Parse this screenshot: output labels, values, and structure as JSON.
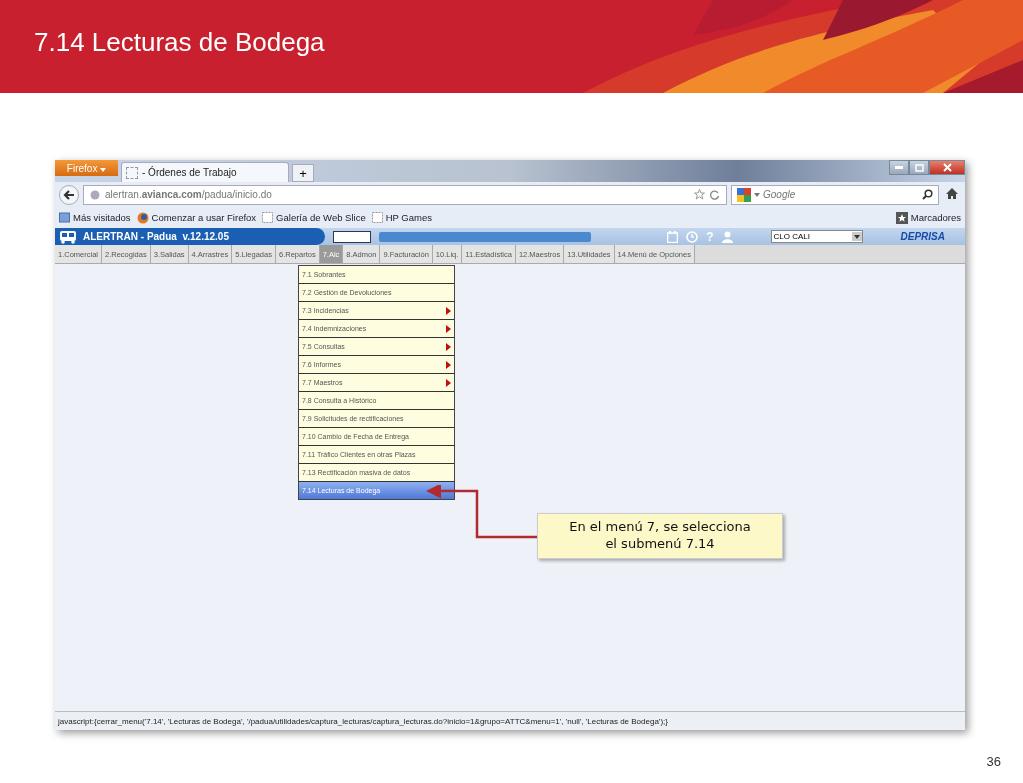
{
  "slide": {
    "title": "7.14 Lecturas de Bodega",
    "page_number": "36"
  },
  "browser": {
    "firefox_button": "Firefox",
    "tab_title": "- Órdenes de Trabajo",
    "new_tab": "+",
    "url": "alertran.**avianca.com**/padua/inicio.do",
    "search_placeholder": "Google",
    "bookmarks": [
      "Más visitados",
      "Comenzar a usar Firefox",
      "Galería de Web Slice",
      "HP Games"
    ],
    "bookmarks_menu": "Marcadores",
    "status_text": "javascript:{cerrar_menu('7.14', 'Lecturas de Bodega', '/padua/utilidades/captura_lecturas/captura_lecturas.do?inicio=1&grupo=ATTC&menu=1', 'null', 'Lecturas de Bodega');}"
  },
  "app": {
    "title": "ALERTRAN - Padua  v.12.12.05",
    "help": "?",
    "office": "CLO CALI",
    "progress": {
      "level": 1
    },
    "brand": "DEPRISA"
  },
  "menu": [
    {
      "label": "1.Comercial",
      "selected": false
    },
    {
      "label": "2.Recogidas",
      "selected": false
    },
    {
      "label": "3.Salidas",
      "selected": false
    },
    {
      "label": "4.Arrastres",
      "selected": false
    },
    {
      "label": "5.Llegadas",
      "selected": false
    },
    {
      "label": "6.Repartos",
      "selected": false
    },
    {
      "label": "7.Alc",
      "selected": true
    },
    {
      "label": "8.Admon",
      "selected": false
    },
    {
      "label": "9.Facturación",
      "selected": false
    },
    {
      "label": "10.Liq.",
      "selected": false
    },
    {
      "label": "11.Estadística",
      "selected": false
    },
    {
      "label": "12.Maestros",
      "selected": false
    },
    {
      "label": "13.Utilidades",
      "selected": false
    },
    {
      "label": "14.Menú de Opciones",
      "selected": false
    }
  ],
  "submenu": [
    {
      "label": "7.1 Sobrantes",
      "has_submenu": false,
      "selected": false
    },
    {
      "label": "7.2 Gestión de Devoluciones",
      "has_submenu": false,
      "selected": false
    },
    {
      "label": "7.3 Incidencias",
      "has_submenu": true,
      "selected": false
    },
    {
      "label": "7.4 Indemnizaciones",
      "has_submenu": true,
      "selected": false
    },
    {
      "label": "7.5 Consultas",
      "has_submenu": true,
      "selected": false
    },
    {
      "label": "7.6 Informes",
      "has_submenu": true,
      "selected": false
    },
    {
      "label": "7.7 Maestros",
      "has_submenu": true,
      "selected": false
    },
    {
      "label": "7.8 Consulta a Histórico",
      "has_submenu": false,
      "selected": false
    },
    {
      "label": "7.9 Solicitudes de rectificaciones",
      "has_submenu": false,
      "selected": false
    },
    {
      "label": "7.10 Cambio de Fecha de Entrega",
      "has_submenu": false,
      "selected": false
    },
    {
      "label": "7.11 Tráfico Clientes en otras Plazas",
      "has_submenu": false,
      "selected": false
    },
    {
      "label": "7.13 Rectificación masiva de datos",
      "has_submenu": false,
      "selected": false
    },
    {
      "label": "7.14 Lecturas de Bodega",
      "has_submenu": false,
      "selected": true
    }
  ],
  "callout": {
    "text": "En el menú 7, se selecciona el submenú 7.14"
  }
}
